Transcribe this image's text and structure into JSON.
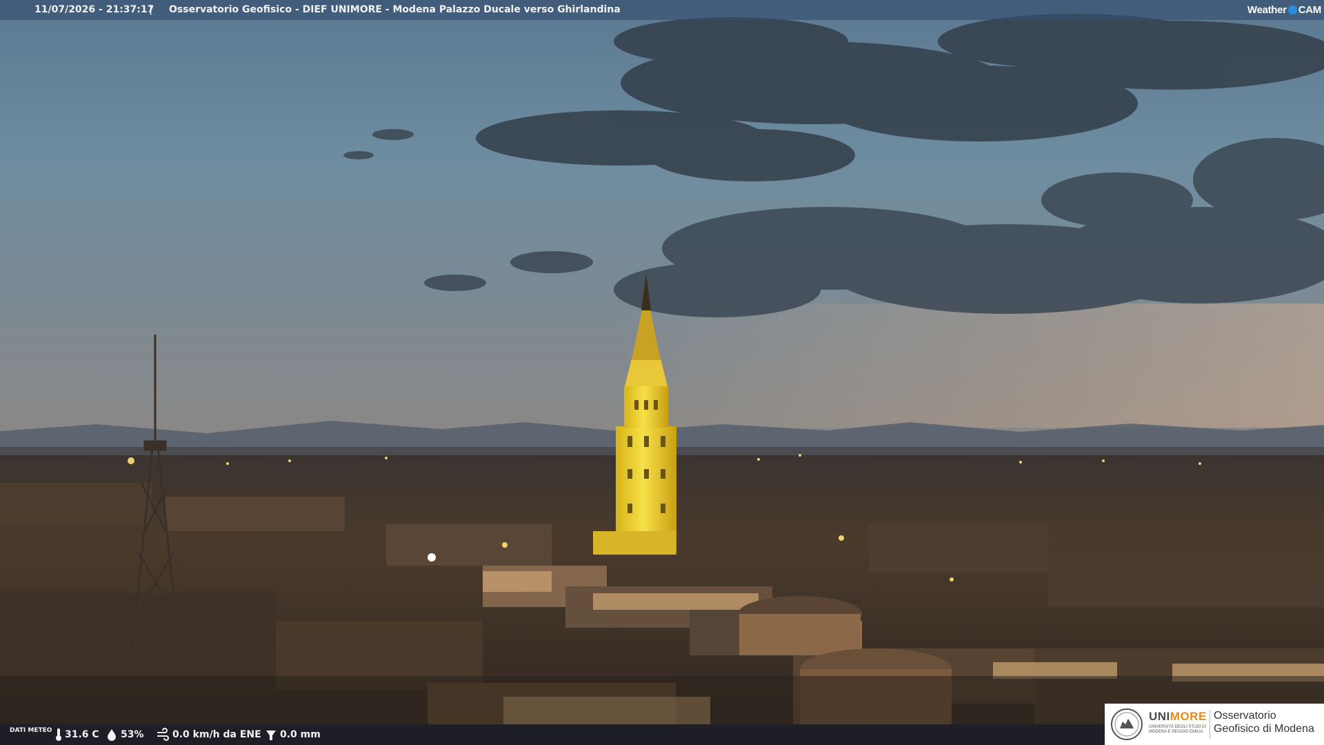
{
  "top_bar": {
    "timestamp": "11/07/2026 - 21:37:17",
    "separator": "|",
    "title": "Osservatorio Geofisico - DIEF UNIMORE - Modena Palazzo Ducale verso Ghirlandina",
    "brand_left": "Weather",
    "brand_right": "CAM"
  },
  "weather": {
    "label": "DATI METEO",
    "temperature": "31.6 C",
    "humidity": "53%",
    "wind": "0.0 km/h da ENE",
    "rain": "0.0 mm"
  },
  "logo": {
    "word_prefix": "UNI",
    "word_suffix": "MORE",
    "subtitle": "UNIVERSITÀ DEGLI STUDI DI MODENA E REGGIO EMILIA",
    "organization": "Osservatorio Geofisico di Modena"
  },
  "colors": {
    "top_bar": "#344c70",
    "unimore_accent": "#e88a1a",
    "tower_light": "#f2d020"
  },
  "icons": {
    "temperature": "thermometer-icon",
    "humidity": "droplet-icon",
    "wind": "wind-icon",
    "rain": "rain-gauge-icon"
  }
}
